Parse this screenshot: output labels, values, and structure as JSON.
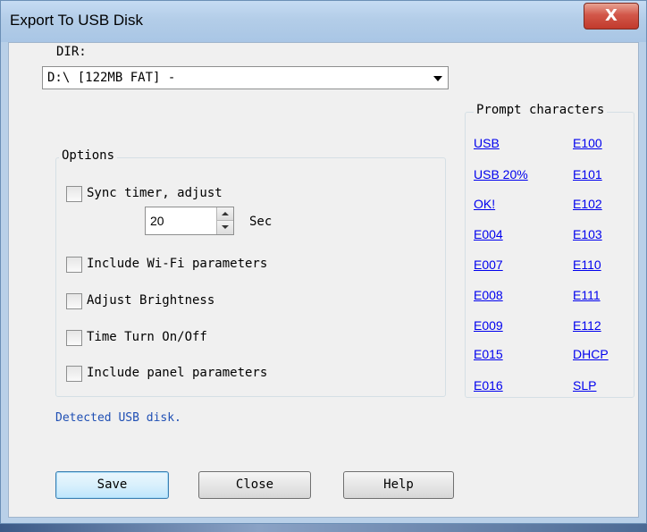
{
  "window": {
    "title": "Export To USB Disk",
    "close_glyph": "X"
  },
  "dir": {
    "label": "DIR:",
    "selected": "D:\\ [122MB FAT] -"
  },
  "options": {
    "title": "Options",
    "sync_timer": {
      "label": "Sync timer, adjust",
      "checked": false
    },
    "timer_value": "20",
    "timer_unit": "Sec",
    "include_wifi": {
      "label": "Include Wi-Fi parameters",
      "checked": false
    },
    "adjust_brightness": {
      "label": "Adjust Brightness",
      "checked": false
    },
    "time_turn": {
      "label": "Time Turn On/Off",
      "checked": false
    },
    "include_panel": {
      "label": "Include panel parameters",
      "checked": false
    }
  },
  "prompt": {
    "title": "Prompt characters",
    "left": [
      "USB",
      "USB 20%",
      "OK!",
      "E004",
      "E007",
      "E008",
      "E009",
      "E015",
      "E016"
    ],
    "right": [
      "E100",
      "E101",
      "E102",
      "E103",
      "E110",
      "E111",
      "E112",
      "DHCP",
      "SLP"
    ]
  },
  "status": "Detected USB disk.",
  "buttons": {
    "save": "Save",
    "close": "Close",
    "help": "Help"
  },
  "colors": {
    "link": "#0000ee",
    "status": "#1f4fb4",
    "title_bar": "#b9d0e8",
    "close_button": "#c13a2c"
  }
}
